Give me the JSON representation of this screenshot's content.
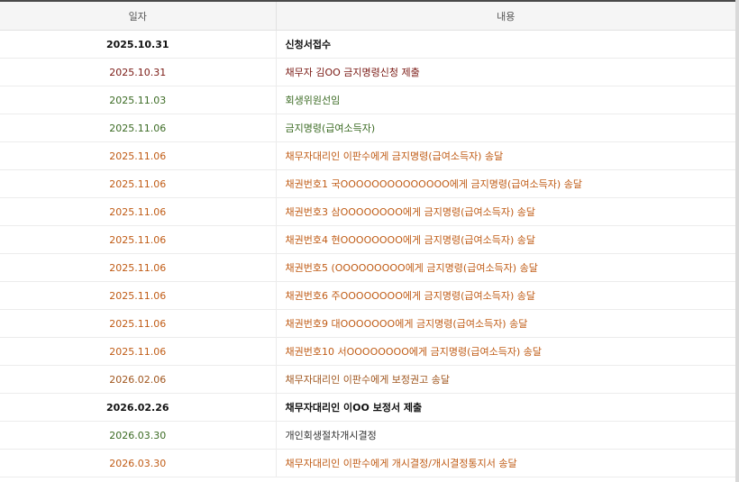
{
  "header": {
    "date_label": "일자",
    "content_label": "내용"
  },
  "colors": {
    "black": "#111111",
    "maroon": "#7a1a14",
    "green": "#3c6b24",
    "orange": "#c05c16",
    "brown": "#a0561e"
  },
  "rows": [
    {
      "date": "2025.10.31",
      "content": "신청서접수",
      "style": "s-black"
    },
    {
      "date": "2025.10.31",
      "content": "채무자 김OO 금지명령신청 제출",
      "style": "s-maroon"
    },
    {
      "date": "2025.11.03",
      "content": "회생위원선임",
      "style": "s-green"
    },
    {
      "date": "2025.11.06",
      "content": "금지명령(급여소득자)",
      "style": "s-green"
    },
    {
      "date": "2025.11.06",
      "content": "채무자대리인 이판수에게 금지명령(급여소득자) 송달",
      "style": "s-orange"
    },
    {
      "date": "2025.11.06",
      "content": "채권번호1 국OOOOOOOOOOOOOO에게 금지명령(급여소득자) 송달",
      "style": "s-orange"
    },
    {
      "date": "2025.11.06",
      "content": "채권번호3 삼OOOOOOOO에게 금지명령(급여소득자) 송달",
      "style": "s-orange"
    },
    {
      "date": "2025.11.06",
      "content": "채권번호4 현OOOOOOOO에게 금지명령(급여소득자) 송달",
      "style": "s-orange"
    },
    {
      "date": "2025.11.06",
      "content": "채권번호5 (OOOOOOOOO에게 금지명령(급여소득자) 송달",
      "style": "s-orange"
    },
    {
      "date": "2025.11.06",
      "content": "채권번호6 주OOOOOOOO에게 금지명령(급여소득자) 송달",
      "style": "s-orange"
    },
    {
      "date": "2025.11.06",
      "content": "채권번호9 대OOOOOOO에게 금지명령(급여소득자) 송달",
      "style": "s-orange"
    },
    {
      "date": "2025.11.06",
      "content": "채권번호10 서OOOOOOOO에게 금지명령(급여소득자) 송달",
      "style": "s-orange"
    },
    {
      "date": "2026.02.06",
      "content": "채무자대리인 이판수에게 보정권고 송달",
      "style": "s-brown"
    },
    {
      "date": "2026.02.26",
      "content": "채무자대리인 이OO 보정서 제출",
      "style": "s-black"
    },
    {
      "date": "2026.03.30",
      "content": "개인회생절차개시결정",
      "style": "s-dark"
    },
    {
      "date": "2026.03.30",
      "content": "채무자대리인 이판수에게 개시결정/개시결정통지서 송달",
      "style": "s-orange"
    }
  ]
}
